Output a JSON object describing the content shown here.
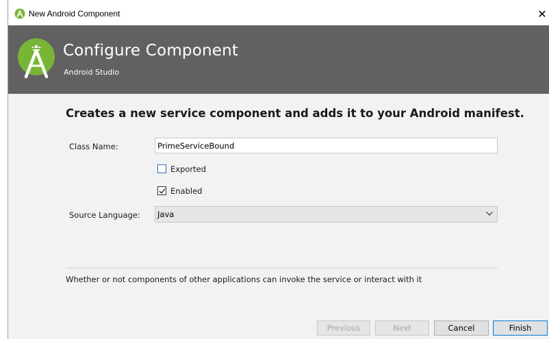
{
  "window": {
    "title": "New Android Component",
    "close_glyph": "✕"
  },
  "banner": {
    "title": "Configure Component",
    "subtitle": "Android Studio",
    "background": "#616161",
    "logo_color": "#78b536"
  },
  "content": {
    "headline": "Creates a new service component and adds it to your Android manifest.",
    "class_name": {
      "label": "Class Name:",
      "value": "PrimeServiceBound"
    },
    "exported": {
      "label": "Exported",
      "checked": false
    },
    "enabled": {
      "label": "Enabled",
      "checked": true
    },
    "source_language": {
      "label": "Source Language:",
      "value": "Java"
    },
    "description": "Whether or not components of other applications can invoke the service or interact with it"
  },
  "buttons": {
    "previous": "Previous",
    "next": "Next",
    "cancel": "Cancel",
    "finish": "Finish"
  },
  "icons": [
    "android-studio-icon",
    "close-icon",
    "android-studio-logo",
    "checkmark-icon",
    "chevron-down-icon"
  ]
}
